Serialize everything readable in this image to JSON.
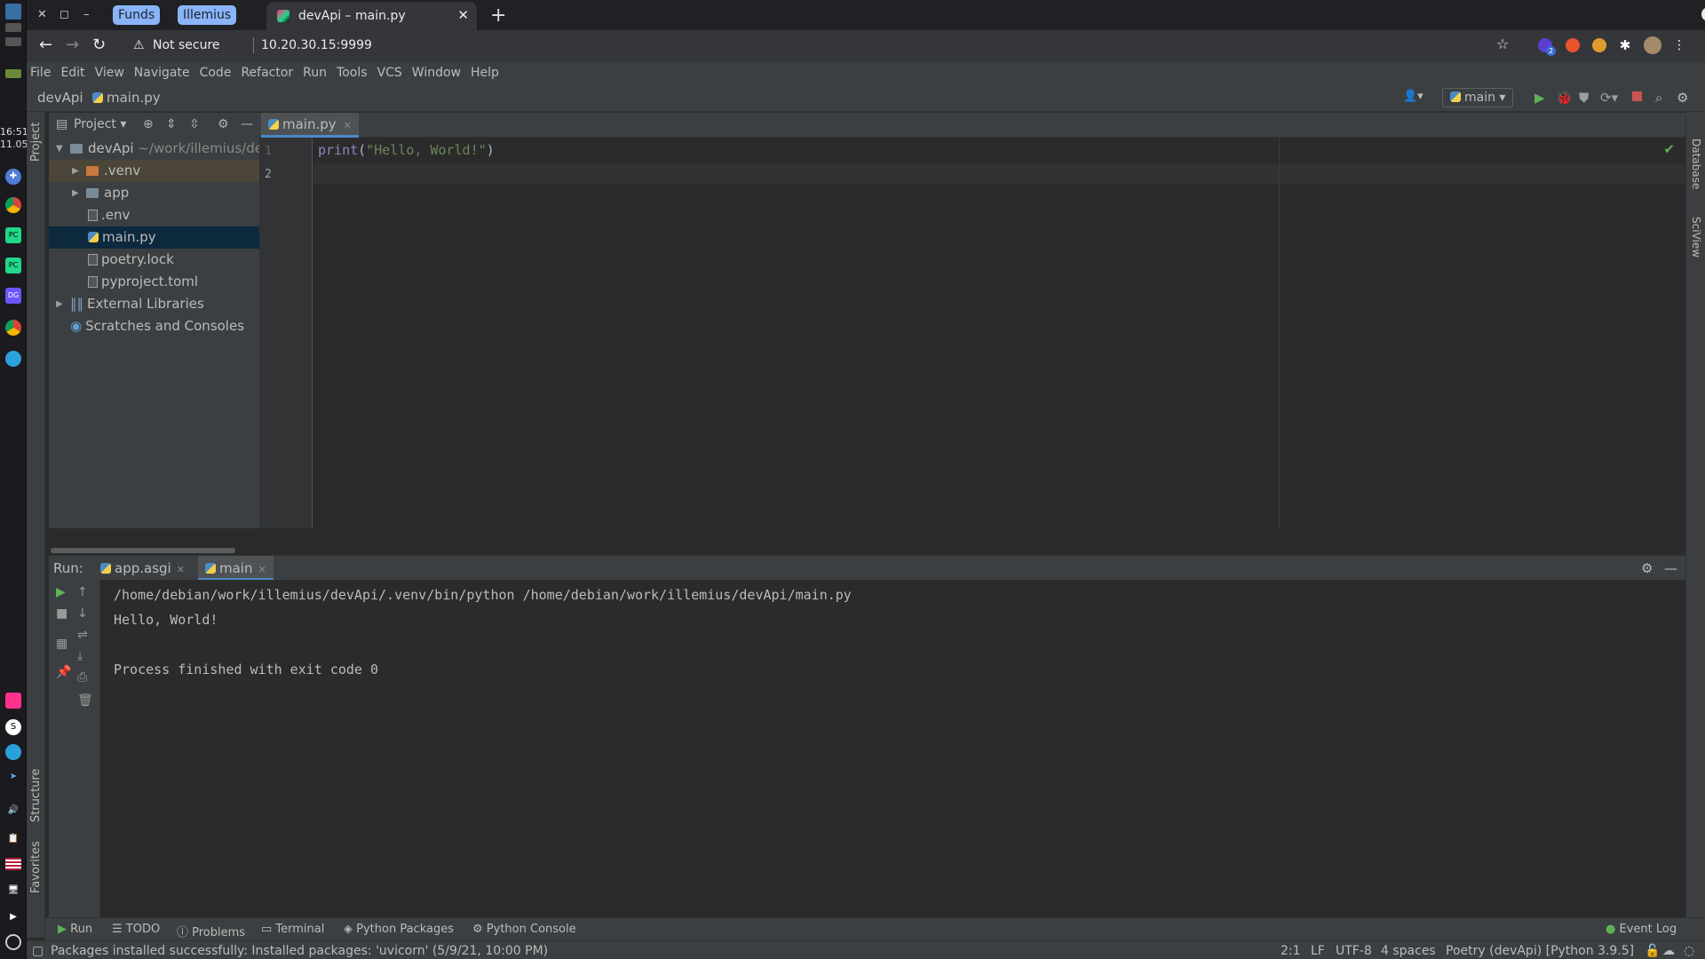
{
  "system": {
    "time": "16:51",
    "date": "11.05"
  },
  "browser": {
    "tab_groups": [
      {
        "label": "Funds",
        "color": "#8ab4f8"
      },
      {
        "label": "Illemius",
        "color": "#8ab4f8"
      }
    ],
    "active_tab_title": "devApi – main.py",
    "security_label": "Not secure",
    "url": "10.20.30.15:9999",
    "extension_badge": "2"
  },
  "ide": {
    "menu": [
      "File",
      "Edit",
      "View",
      "Navigate",
      "Code",
      "Refactor",
      "Run",
      "Tools",
      "VCS",
      "Window",
      "Help"
    ],
    "breadcrumb": {
      "project": "devApi",
      "file": "main.py"
    },
    "run_config": "main",
    "left_strip": {
      "project": "Project",
      "structure": "Structure",
      "favorites": "Favorites"
    },
    "right_strip": {
      "database": "Database",
      "sciview": "SciView"
    },
    "project_panel": {
      "title": "Project",
      "root": {
        "name": "devApi",
        "path": "~/work/illemius/dev"
      },
      "items": [
        {
          "name": ".venv",
          "type": "folder-excluded"
        },
        {
          "name": "app",
          "type": "folder"
        },
        {
          "name": ".env",
          "type": "file"
        },
        {
          "name": "main.py",
          "type": "python",
          "selected": true
        },
        {
          "name": "poetry.lock",
          "type": "file"
        },
        {
          "name": "pyproject.toml",
          "type": "file"
        }
      ],
      "external_libraries": "External Libraries",
      "scratches": "Scratches and Consoles"
    },
    "editor": {
      "tab": "main.py",
      "line_numbers": [
        "1",
        "2"
      ],
      "code": {
        "func": "print",
        "open": "(",
        "arg": "\"Hello, World!\"",
        "close": ")"
      }
    },
    "run_panel": {
      "label": "Run:",
      "tabs": [
        "app.asgi",
        "main"
      ],
      "active_tab": "main",
      "output": [
        "/home/debian/work/illemius/devApi/.venv/bin/python /home/debian/work/illemius/devApi/main.py",
        "Hello, World!",
        "",
        "Process finished with exit code 0"
      ]
    },
    "bottom_tools": [
      "Run",
      "TODO",
      "Problems",
      "Terminal",
      "Python Packages",
      "Python Console"
    ],
    "event_log": "Event Log",
    "status": {
      "message": "Packages installed successfully: Installed packages: 'uvicorn' (5/9/21, 10:00 PM)",
      "position": "2:1",
      "line_sep": "LF",
      "encoding": "UTF-8",
      "indent": "4 spaces",
      "interpreter": "Poetry (devApi) [Python 3.9.5]"
    }
  },
  "colors": {
    "accent": "#4a88c7",
    "run_green": "#5fb157",
    "stop_red": "#c75450"
  }
}
